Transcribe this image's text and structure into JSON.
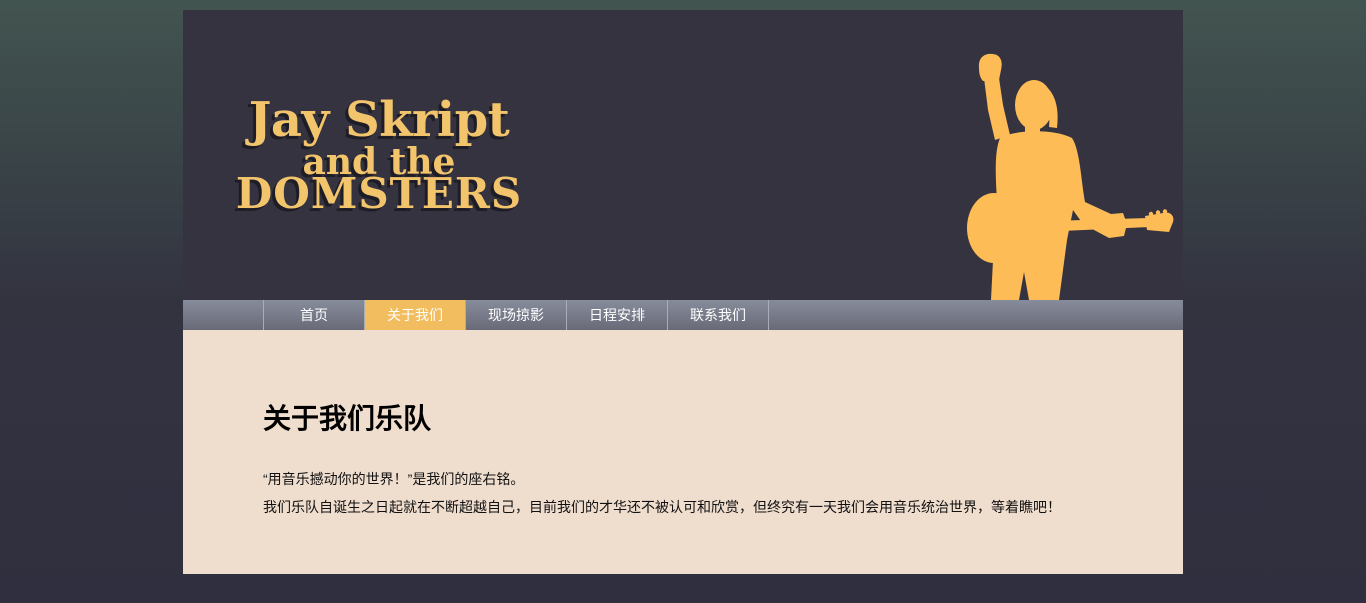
{
  "page": {
    "background_top_color": "#425450",
    "background_bottom_color": "#302f3f"
  },
  "header": {
    "background_color": "#35333f",
    "logo": {
      "line1": "Jay Skript",
      "line2": "and the",
      "line3": "DOMSTERS",
      "color": "#f2c46c",
      "shadow_color": "#1e1d25"
    },
    "illustration": {
      "icon": "guitarist-silhouette",
      "color": "#fdbc56"
    }
  },
  "nav": {
    "active_color": "#f1bd5f",
    "items": [
      {
        "label": "首页",
        "active": false
      },
      {
        "label": "关于我们",
        "active": true
      },
      {
        "label": "现场掠影",
        "active": false
      },
      {
        "label": "日程安排",
        "active": false
      },
      {
        "label": "联系我们",
        "active": false
      }
    ]
  },
  "main": {
    "background_color": "#efddce",
    "heading": "关于我们乐队",
    "paragraphs": [
      "“用音乐撼动你的世界！”是我们的座右铭。",
      "我们乐队自诞生之日起就在不断超越自己，目前我们的才华还不被认可和欣赏，但终究有一天我们会用音乐统治世界，等着瞧吧！"
    ]
  }
}
